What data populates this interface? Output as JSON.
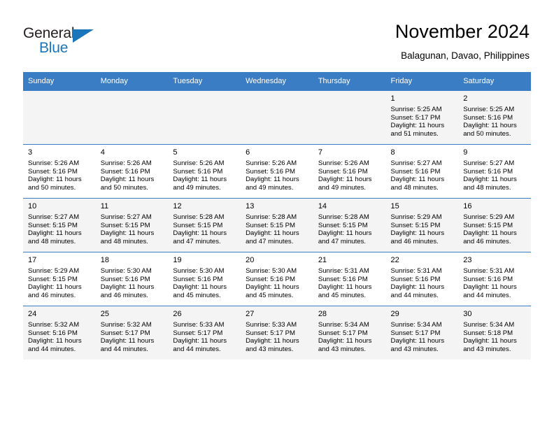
{
  "logo": {
    "word_one": "General",
    "word_two": "Blue",
    "accent_color": "#1b75bb",
    "triangle_icon": "triangle-icon"
  },
  "header": {
    "title": "November 2024",
    "subtitle": "Balagunan, Davao, Philippines",
    "header_bg_color": "#3b7dc4"
  },
  "calendar": {
    "weekdays": [
      "Sunday",
      "Monday",
      "Tuesday",
      "Wednesday",
      "Thursday",
      "Friday",
      "Saturday"
    ],
    "weeks": [
      [
        {
          "day": "",
          "detail": "",
          "empty": true
        },
        {
          "day": "",
          "detail": "",
          "empty": true
        },
        {
          "day": "",
          "detail": "",
          "empty": true
        },
        {
          "day": "",
          "detail": "",
          "empty": true
        },
        {
          "day": "",
          "detail": "",
          "empty": true
        },
        {
          "day": "1",
          "detail": "Sunrise: 5:25 AM\nSunset: 5:17 PM\nDaylight: 11 hours\nand 51 minutes.",
          "empty": false
        },
        {
          "day": "2",
          "detail": "Sunrise: 5:25 AM\nSunset: 5:16 PM\nDaylight: 11 hours\nand 50 minutes.",
          "empty": false
        }
      ],
      [
        {
          "day": "3",
          "detail": "Sunrise: 5:26 AM\nSunset: 5:16 PM\nDaylight: 11 hours\nand 50 minutes.",
          "empty": false
        },
        {
          "day": "4",
          "detail": "Sunrise: 5:26 AM\nSunset: 5:16 PM\nDaylight: 11 hours\nand 50 minutes.",
          "empty": false
        },
        {
          "day": "5",
          "detail": "Sunrise: 5:26 AM\nSunset: 5:16 PM\nDaylight: 11 hours\nand 49 minutes.",
          "empty": false
        },
        {
          "day": "6",
          "detail": "Sunrise: 5:26 AM\nSunset: 5:16 PM\nDaylight: 11 hours\nand 49 minutes.",
          "empty": false
        },
        {
          "day": "7",
          "detail": "Sunrise: 5:26 AM\nSunset: 5:16 PM\nDaylight: 11 hours\nand 49 minutes.",
          "empty": false
        },
        {
          "day": "8",
          "detail": "Sunrise: 5:27 AM\nSunset: 5:16 PM\nDaylight: 11 hours\nand 48 minutes.",
          "empty": false
        },
        {
          "day": "9",
          "detail": "Sunrise: 5:27 AM\nSunset: 5:16 PM\nDaylight: 11 hours\nand 48 minutes.",
          "empty": false
        }
      ],
      [
        {
          "day": "10",
          "detail": "Sunrise: 5:27 AM\nSunset: 5:15 PM\nDaylight: 11 hours\nand 48 minutes.",
          "empty": false
        },
        {
          "day": "11",
          "detail": "Sunrise: 5:27 AM\nSunset: 5:15 PM\nDaylight: 11 hours\nand 48 minutes.",
          "empty": false
        },
        {
          "day": "12",
          "detail": "Sunrise: 5:28 AM\nSunset: 5:15 PM\nDaylight: 11 hours\nand 47 minutes.",
          "empty": false
        },
        {
          "day": "13",
          "detail": "Sunrise: 5:28 AM\nSunset: 5:15 PM\nDaylight: 11 hours\nand 47 minutes.",
          "empty": false
        },
        {
          "day": "14",
          "detail": "Sunrise: 5:28 AM\nSunset: 5:15 PM\nDaylight: 11 hours\nand 47 minutes.",
          "empty": false
        },
        {
          "day": "15",
          "detail": "Sunrise: 5:29 AM\nSunset: 5:15 PM\nDaylight: 11 hours\nand 46 minutes.",
          "empty": false
        },
        {
          "day": "16",
          "detail": "Sunrise: 5:29 AM\nSunset: 5:15 PM\nDaylight: 11 hours\nand 46 minutes.",
          "empty": false
        }
      ],
      [
        {
          "day": "17",
          "detail": "Sunrise: 5:29 AM\nSunset: 5:15 PM\nDaylight: 11 hours\nand 46 minutes.",
          "empty": false
        },
        {
          "day": "18",
          "detail": "Sunrise: 5:30 AM\nSunset: 5:16 PM\nDaylight: 11 hours\nand 46 minutes.",
          "empty": false
        },
        {
          "day": "19",
          "detail": "Sunrise: 5:30 AM\nSunset: 5:16 PM\nDaylight: 11 hours\nand 45 minutes.",
          "empty": false
        },
        {
          "day": "20",
          "detail": "Sunrise: 5:30 AM\nSunset: 5:16 PM\nDaylight: 11 hours\nand 45 minutes.",
          "empty": false
        },
        {
          "day": "21",
          "detail": "Sunrise: 5:31 AM\nSunset: 5:16 PM\nDaylight: 11 hours\nand 45 minutes.",
          "empty": false
        },
        {
          "day": "22",
          "detail": "Sunrise: 5:31 AM\nSunset: 5:16 PM\nDaylight: 11 hours\nand 44 minutes.",
          "empty": false
        },
        {
          "day": "23",
          "detail": "Sunrise: 5:31 AM\nSunset: 5:16 PM\nDaylight: 11 hours\nand 44 minutes.",
          "empty": false
        }
      ],
      [
        {
          "day": "24",
          "detail": "Sunrise: 5:32 AM\nSunset: 5:16 PM\nDaylight: 11 hours\nand 44 minutes.",
          "empty": false
        },
        {
          "day": "25",
          "detail": "Sunrise: 5:32 AM\nSunset: 5:17 PM\nDaylight: 11 hours\nand 44 minutes.",
          "empty": false
        },
        {
          "day": "26",
          "detail": "Sunrise: 5:33 AM\nSunset: 5:17 PM\nDaylight: 11 hours\nand 44 minutes.",
          "empty": false
        },
        {
          "day": "27",
          "detail": "Sunrise: 5:33 AM\nSunset: 5:17 PM\nDaylight: 11 hours\nand 43 minutes.",
          "empty": false
        },
        {
          "day": "28",
          "detail": "Sunrise: 5:34 AM\nSunset: 5:17 PM\nDaylight: 11 hours\nand 43 minutes.",
          "empty": false
        },
        {
          "day": "29",
          "detail": "Sunrise: 5:34 AM\nSunset: 5:17 PM\nDaylight: 11 hours\nand 43 minutes.",
          "empty": false
        },
        {
          "day": "30",
          "detail": "Sunrise: 5:34 AM\nSunset: 5:18 PM\nDaylight: 11 hours\nand 43 minutes.",
          "empty": false
        }
      ]
    ]
  }
}
